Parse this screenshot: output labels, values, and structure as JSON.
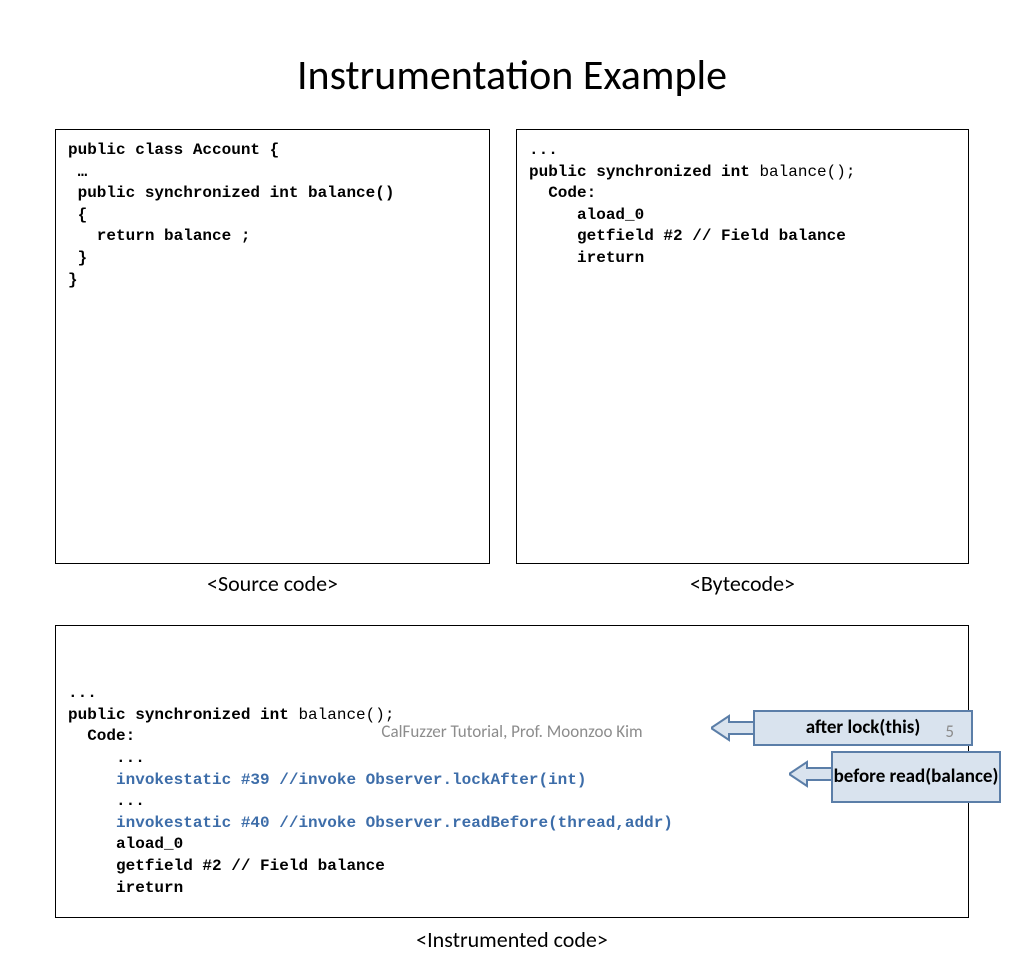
{
  "title": "Instrumentation Example",
  "source_box": {
    "lines": [
      "public class Account {",
      " …",
      " public synchronized int balance()",
      " {",
      "   return balance ;",
      " }",
      "}"
    ],
    "label": "<Source code>"
  },
  "bytecode_box": {
    "lines": [
      {
        "t": "..."
      },
      {
        "t": "public synchronized int ",
        "tail": "balance();",
        "tail_nonbold": true
      },
      {
        "t": "  Code:"
      },
      {
        "t": "     aload_0"
      },
      {
        "t": "     getfield #2 // Field balance"
      },
      {
        "t": "     ireturn"
      }
    ],
    "label": "<Bytecode>"
  },
  "instrumented_box": {
    "lines": [
      {
        "t": "...",
        "cls": ""
      },
      {
        "t": "public synchronized int ",
        "tail": "balance();",
        "tail_nonbold": true,
        "cls": ""
      },
      {
        "t": "  Code:",
        "cls": ""
      },
      {
        "t": "     ...",
        "cls": ""
      },
      {
        "t": "     invokestatic #39 //invoke Observer.lockAfter(int)",
        "cls": "blue-line"
      },
      {
        "t": "     ...",
        "cls": ""
      },
      {
        "t": "     invokestatic #40 //invoke Observer.readBefore(thread,addr)",
        "cls": "blue-line"
      },
      {
        "t": "     aload_0",
        "cls": ""
      },
      {
        "t": "     getfield #2 // Field balance",
        "cls": ""
      },
      {
        "t": "     ireturn",
        "cls": ""
      }
    ],
    "label": "<Instrumented code>",
    "callout1": "after lock(this)",
    "callout2": "before read(balance)"
  },
  "footer": "CalFuzzer Tutorial, Prof. Moonzoo Kim",
  "page": "5"
}
